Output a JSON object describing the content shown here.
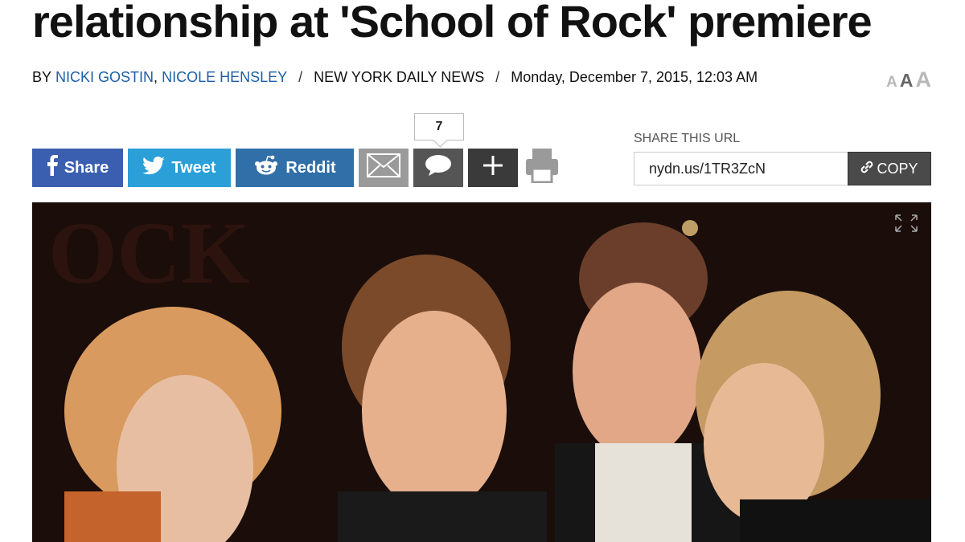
{
  "article": {
    "headline": "relationship at 'School of Rock' premiere",
    "byline_prefix": "BY",
    "authors": [
      "NICKI GOSTIN",
      "NICOLE HENSLEY"
    ],
    "author_separator": ",",
    "slash": "/",
    "publication": "NEW YORK DAILY NEWS",
    "date": "Monday, December 7, 2015, 12:03 AM"
  },
  "text_size": {
    "small": "A",
    "medium": "A",
    "large": "A"
  },
  "share": {
    "facebook_label": "Share",
    "twitter_label": "Tweet",
    "reddit_label": "Reddit",
    "comment_count": "7",
    "url_label": "SHARE THIS URL",
    "url_value": "nydn.us/1TR3ZcN",
    "copy_label": "COPY"
  },
  "colors": {
    "facebook": "#3b5fb0",
    "twitter": "#2a9fd8",
    "reddit": "#316fa8",
    "author_link": "#1a5fa8"
  },
  "icons": [
    "facebook-icon",
    "twitter-icon",
    "reddit-icon",
    "email-icon",
    "comment-icon",
    "plus-icon",
    "print-icon",
    "link-icon",
    "expand-icon"
  ]
}
